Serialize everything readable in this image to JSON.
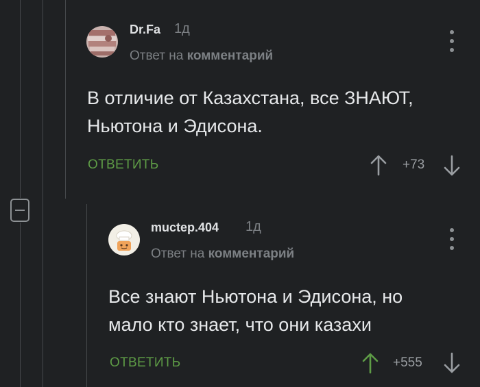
{
  "thread": {
    "collapse_label": "collapse"
  },
  "comments": [
    {
      "username": "Dr.Fa",
      "time": "1д",
      "reply_prefix": "Ответ на",
      "reply_link": "комментарий",
      "text_line1": "В отличие от Казахстана, все ЗНАЮТ,",
      "text_line2": "Ньютона и Эдисона.",
      "reply_label": "ОТВЕТИТЬ",
      "rating": "+73",
      "voted_up": false
    },
    {
      "username": "muctep.404",
      "time": "1д",
      "reply_prefix": "Ответ на",
      "reply_link": "комментарий",
      "text_line1": "Все знают Ньютона и Эдисона, но",
      "text_line2": "мало кто знает, что они казахи",
      "reply_label": "ОТВЕТИТЬ",
      "rating": "+555",
      "voted_up": true
    }
  ],
  "colors": {
    "background": "#1f2123",
    "accent_green": "#5e9c46",
    "muted": "#7c8084",
    "text": "#e6e8ea"
  }
}
